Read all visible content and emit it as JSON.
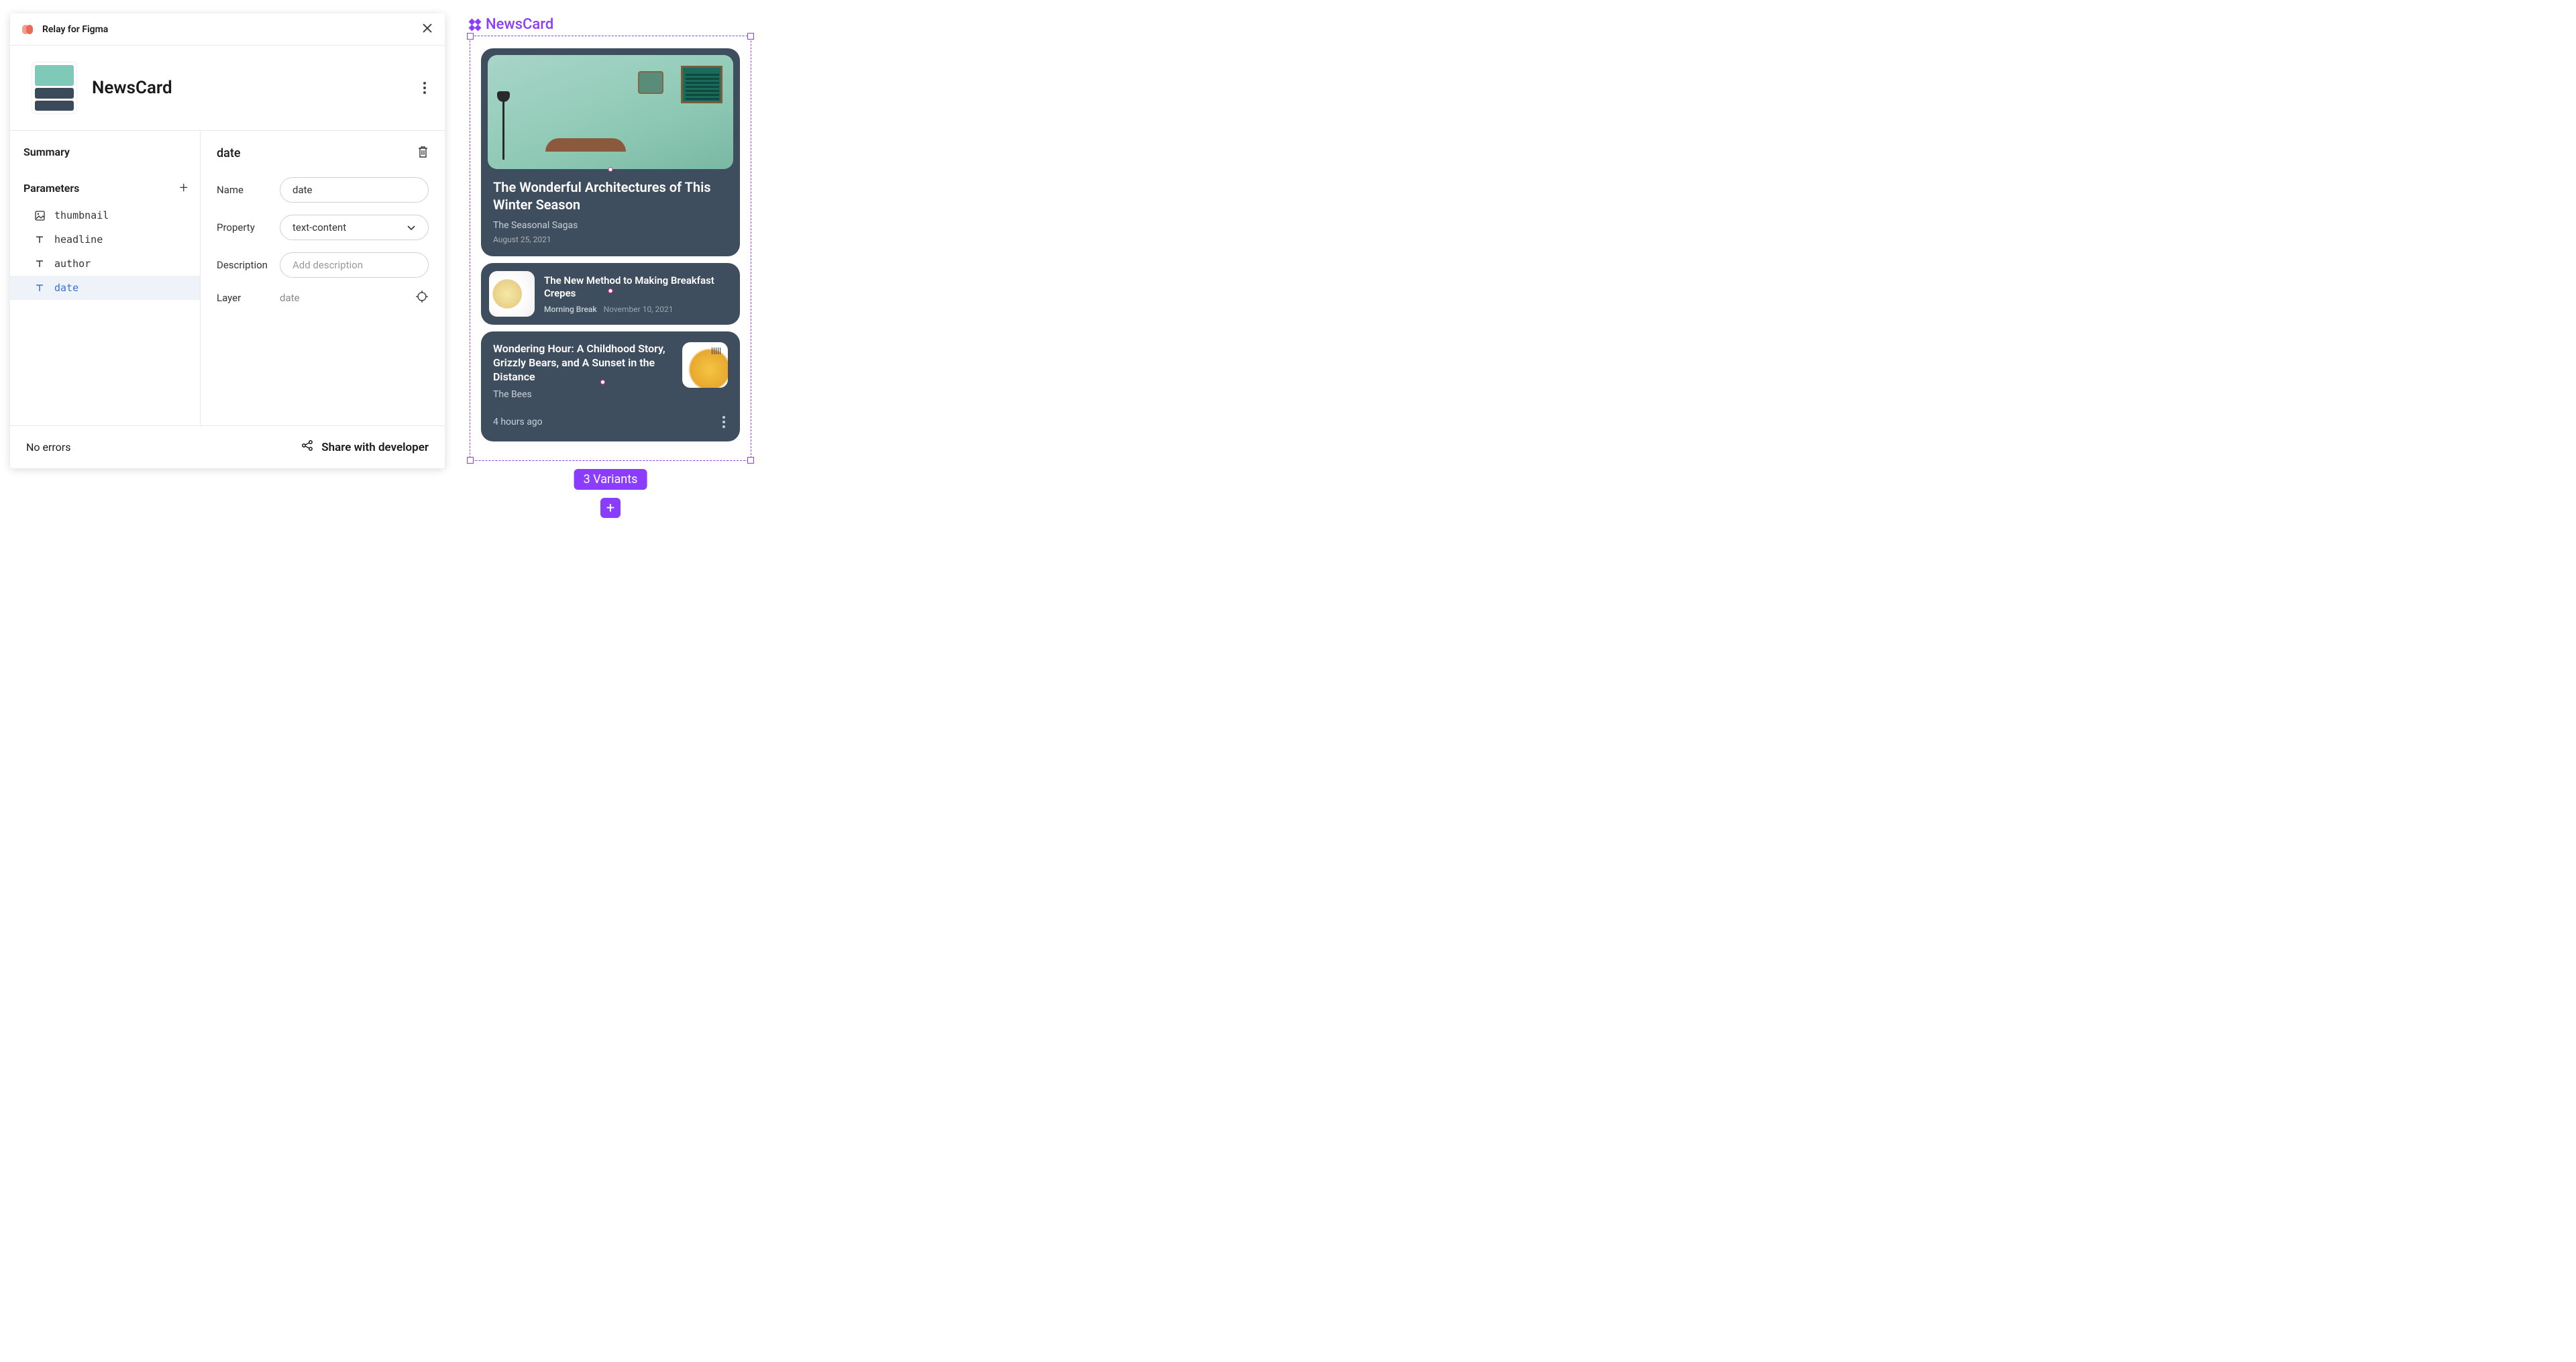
{
  "plugin": {
    "title": "Relay for Figma",
    "component_name": "NewsCard",
    "sidebar": {
      "summary_label": "Summary",
      "parameters_label": "Parameters",
      "params": [
        {
          "icon": "image",
          "name": "thumbnail"
        },
        {
          "icon": "text",
          "name": "headline"
        },
        {
          "icon": "text",
          "name": "author"
        },
        {
          "icon": "text",
          "name": "date"
        }
      ],
      "selected_index": 3
    },
    "detail": {
      "title": "date",
      "fields": {
        "name_label": "Name",
        "name_value": "date",
        "property_label": "Property",
        "property_value": "text-content",
        "description_label": "Description",
        "description_placeholder": "Add description",
        "layer_label": "Layer",
        "layer_value": "date"
      }
    },
    "footer": {
      "status": "No errors",
      "share_label": "Share with developer"
    }
  },
  "canvas": {
    "component_label": "NewsCard",
    "variants_badge": "3 Variants",
    "cards": [
      {
        "title": "The Wonderful Architectures of This Winter Season",
        "author": "The Seasonal Sagas",
        "date": "August 25, 2021"
      },
      {
        "title": "The New Method to Making Breakfast Crepes",
        "author": "Morning Break",
        "date": "November 10, 2021"
      },
      {
        "title": "Wondering Hour: A Childhood Story, Grizzly Bears, and A Sunset in the Distance",
        "author": "The Bees",
        "date": "4 hours ago"
      }
    ]
  }
}
